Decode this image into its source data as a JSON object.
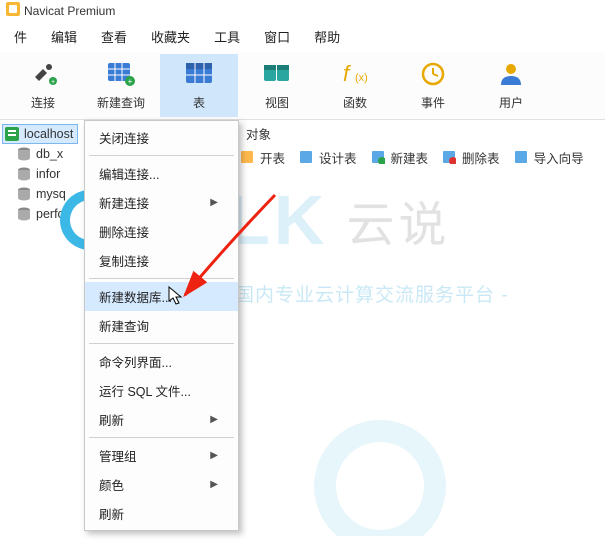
{
  "app": {
    "title": "Navicat Premium"
  },
  "menubar": [
    "件",
    "编辑",
    "查看",
    "收藏夹",
    "工具",
    "窗口",
    "帮助"
  ],
  "toolbar": [
    {
      "name": "connect",
      "label": "连接",
      "color": "#2f2f2f"
    },
    {
      "name": "newquery",
      "label": "新建查询",
      "color": "#3a7bd5"
    },
    {
      "name": "table",
      "label": "表",
      "color": "#3a7bd5",
      "active": true
    },
    {
      "name": "view",
      "label": "视图",
      "color": "#2aa6a0"
    },
    {
      "name": "function",
      "label": "函数",
      "color": "#e7a800"
    },
    {
      "name": "event",
      "label": "事件",
      "color": "#e7a800"
    },
    {
      "name": "user",
      "label": "用户",
      "color": "#e7a800"
    }
  ],
  "tree": {
    "root": {
      "label": "localhost",
      "selected": true
    },
    "children": [
      {
        "label": "db_x"
      },
      {
        "label": "infor"
      },
      {
        "label": "mysq"
      },
      {
        "label": "perfo"
      }
    ]
  },
  "content": {
    "tab": "对象"
  },
  "sub_toolbar": [
    {
      "label": "开表"
    },
    {
      "label": "设计表"
    },
    {
      "label": "新建表"
    },
    {
      "label": "删除表"
    },
    {
      "label": "导入向导"
    }
  ],
  "context_menu": [
    {
      "label": "关闭连接"
    },
    {
      "sep": true
    },
    {
      "label": "编辑连接..."
    },
    {
      "label": "新建连接",
      "submenu": true
    },
    {
      "label": "删除连接"
    },
    {
      "label": "复制连接"
    },
    {
      "sep": true
    },
    {
      "label": "新建数据库...",
      "selected": true
    },
    {
      "label": "新建查询"
    },
    {
      "sep": true
    },
    {
      "label": "命令列界面..."
    },
    {
      "label": "运行 SQL 文件..."
    },
    {
      "label": "刷新",
      "submenu": true
    },
    {
      "sep": true
    },
    {
      "label": "管理组",
      "submenu": true
    },
    {
      "label": "颜色",
      "submenu": true
    },
    {
      "label": "刷新"
    }
  ],
  "watermark": {
    "logo_letters": "TALK",
    "logo_cn": "云说",
    "line2": "- www.          k.com- 国内专业云计算交流服务平台 -"
  }
}
